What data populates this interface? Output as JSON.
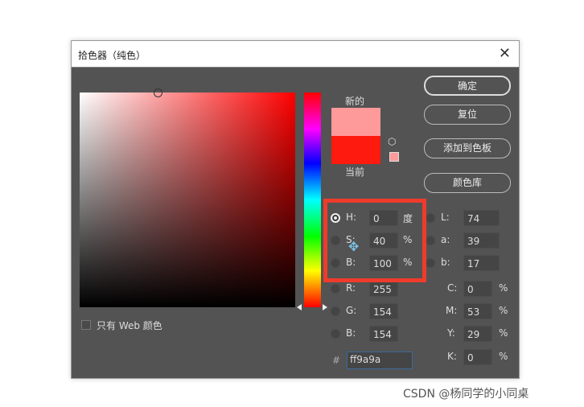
{
  "dialog": {
    "title": "拾色器（纯色）",
    "close_icon": "close-icon"
  },
  "labels": {
    "new": "新的",
    "current": "当前"
  },
  "colors": {
    "new": "#ff9a9a",
    "current": "#ff1a0f",
    "highlight": "#ee3b2c"
  },
  "buttons": {
    "ok": "确定",
    "reset": "复位",
    "add_swatch": "添加到色板",
    "color_library": "颜色库"
  },
  "hsb": [
    {
      "label": "H:",
      "value": "0",
      "unit": "度",
      "selected": true
    },
    {
      "label": "S:",
      "value": "40",
      "unit": "%"
    },
    {
      "label": "B:",
      "value": "100",
      "unit": "%"
    }
  ],
  "rgb": [
    {
      "label": "R:",
      "value": "255"
    },
    {
      "label": "G:",
      "value": "154"
    },
    {
      "label": "B:",
      "value": "154"
    }
  ],
  "lab": [
    {
      "label": "L:",
      "value": "74"
    },
    {
      "label": "a:",
      "value": "39"
    },
    {
      "label": "b:",
      "value": "17"
    }
  ],
  "cmyk": [
    {
      "label": "C:",
      "value": "0",
      "unit": "%"
    },
    {
      "label": "M:",
      "value": "53",
      "unit": "%"
    },
    {
      "label": "Y:",
      "value": "29",
      "unit": "%"
    },
    {
      "label": "K:",
      "value": "0",
      "unit": "%"
    }
  ],
  "hex": {
    "label": "#",
    "value": "ff9a9a"
  },
  "web_only": {
    "label": "只有 Web 颜色",
    "checked": false
  },
  "watermark": "CSDN @杨同学的小同桌"
}
